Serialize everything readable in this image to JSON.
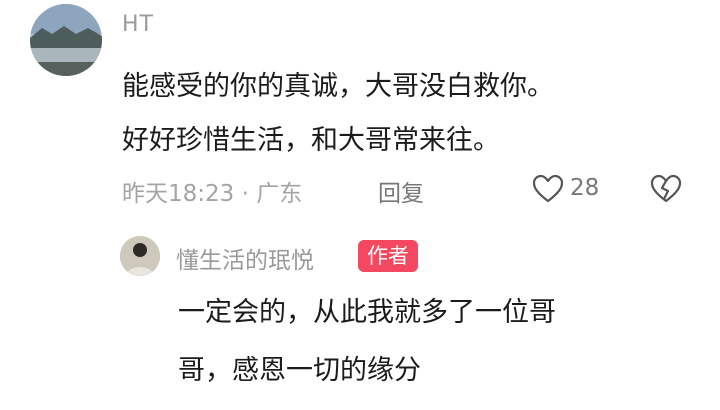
{
  "main_comment": {
    "username": "HT",
    "lines": [
      "能感受的你的真诚，大哥没白救你。",
      "好好珍惜生活，和大哥常来往。"
    ],
    "meta": "昨天18:23 · 广东",
    "reply_label": "回复",
    "like_count": "28",
    "icons": [
      "heart-outline-icon",
      "broken-heart-outline-icon"
    ]
  },
  "reply_comment": {
    "username": "懂生活的珉悦",
    "badge": "作者",
    "lines": [
      "一定会的，从此我就多了一位哥",
      "哥，感恩一切的缘分"
    ]
  },
  "colors": {
    "badge": "#f3485f",
    "text": "#1b1b1b",
    "muted": "#a4a4a4"
  }
}
